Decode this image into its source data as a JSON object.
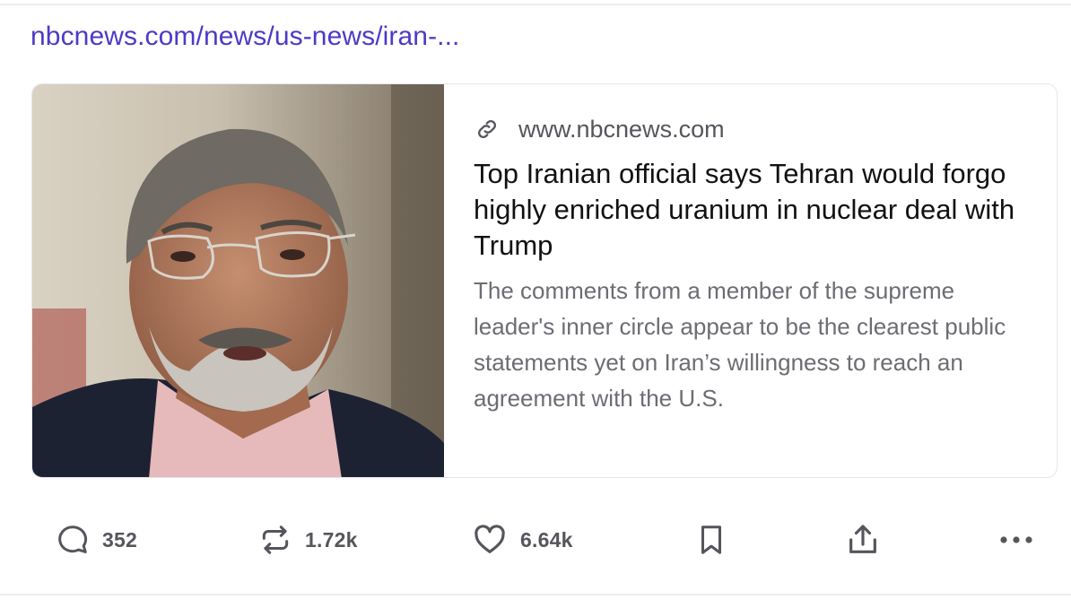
{
  "post": {
    "link_text": "nbcnews.com/news/us-news/iran-..."
  },
  "card": {
    "domain": "www.nbcnews.com",
    "headline": "Top Iranian official says Tehran would forgo highly enriched uranium in nuclear deal with Trump",
    "description": "The comments from a member of the supreme leader's inner circle appear to be the clearest public statements yet on Iran’s willingness to reach an agreement with the U.S.",
    "image_icon": "man-portrait-photo",
    "link_icon": "link-icon"
  },
  "actions": {
    "replies": {
      "icon": "comment-icon",
      "count": "352"
    },
    "reposts": {
      "icon": "repost-icon",
      "count": "1.72k"
    },
    "likes": {
      "icon": "heart-icon",
      "count": "6.64k"
    },
    "bookmark": {
      "icon": "bookmark-icon"
    },
    "share": {
      "icon": "share-icon"
    },
    "more": {
      "icon": "more-icon"
    }
  },
  "colors": {
    "link": "#4b3bc6",
    "headline": "#111114",
    "description": "#6c6c73",
    "icon": "#55555c"
  }
}
